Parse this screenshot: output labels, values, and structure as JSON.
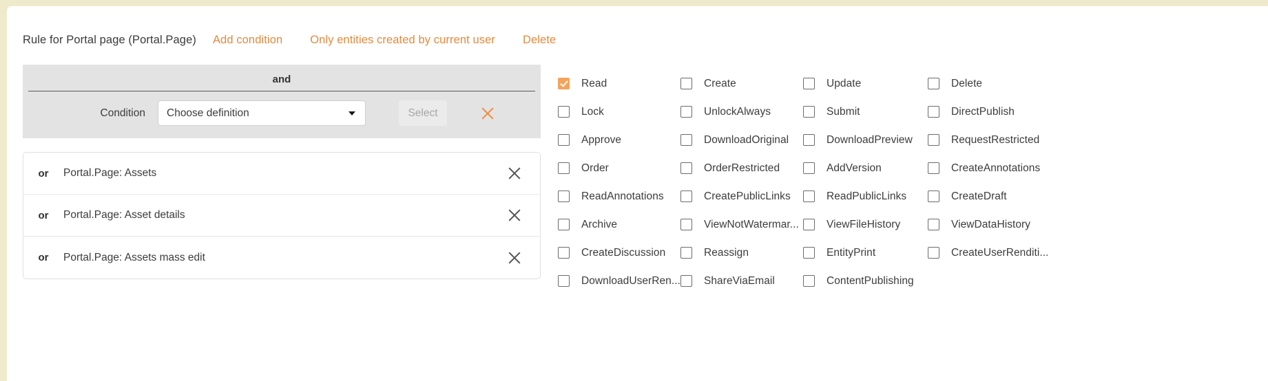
{
  "rule": {
    "title": "Rule for Portal page (Portal.Page)",
    "actions": [
      {
        "label": "Add condition",
        "name": "add-condition-link"
      },
      {
        "label": "Only entities created by current user",
        "name": "only-entities-link"
      },
      {
        "label": "Delete",
        "name": "delete-rule-link"
      }
    ]
  },
  "conditions": {
    "group_operator": "and",
    "condition_label": "Condition",
    "definition_value": "Choose definition",
    "definition_placeholder": "Choose definition",
    "select_button": "Select",
    "or_operator": "or",
    "or_rows": [
      {
        "operator": "or",
        "text": "Portal.Page: Assets"
      },
      {
        "operator": "or",
        "text": "Portal.Page: Asset details"
      },
      {
        "operator": "or",
        "text": "Portal.Page: Assets mass edit"
      }
    ]
  },
  "colors": {
    "accent": "#e8883a",
    "checkbox_checked": "#f5a35b",
    "panel_gray": "#e3e3e3",
    "page_background": "#efeacb"
  },
  "permissions": [
    {
      "label": "Read",
      "checked": true
    },
    {
      "label": "Create",
      "checked": false
    },
    {
      "label": "Update",
      "checked": false
    },
    {
      "label": "Delete",
      "checked": false
    },
    {
      "label": "Lock",
      "checked": false
    },
    {
      "label": "UnlockAlways",
      "checked": false
    },
    {
      "label": "Submit",
      "checked": false
    },
    {
      "label": "DirectPublish",
      "checked": false
    },
    {
      "label": "Approve",
      "checked": false
    },
    {
      "label": "DownloadOriginal",
      "checked": false
    },
    {
      "label": "DownloadPreview",
      "checked": false
    },
    {
      "label": "RequestRestricted",
      "checked": false
    },
    {
      "label": "Order",
      "checked": false
    },
    {
      "label": "OrderRestricted",
      "checked": false
    },
    {
      "label": "AddVersion",
      "checked": false
    },
    {
      "label": "CreateAnnotations",
      "checked": false
    },
    {
      "label": "ReadAnnotations",
      "checked": false
    },
    {
      "label": "CreatePublicLinks",
      "checked": false
    },
    {
      "label": "ReadPublicLinks",
      "checked": false
    },
    {
      "label": "CreateDraft",
      "checked": false
    },
    {
      "label": "Archive",
      "checked": false
    },
    {
      "label": "ViewNotWatermar...",
      "checked": false
    },
    {
      "label": "ViewFileHistory",
      "checked": false
    },
    {
      "label": "ViewDataHistory",
      "checked": false
    },
    {
      "label": "CreateDiscussion",
      "checked": false
    },
    {
      "label": "Reassign",
      "checked": false
    },
    {
      "label": "EntityPrint",
      "checked": false
    },
    {
      "label": "CreateUserRenditi...",
      "checked": false
    },
    {
      "label": "DownloadUserRen...",
      "checked": false
    },
    {
      "label": "ShareViaEmail",
      "checked": false
    },
    {
      "label": "ContentPublishing",
      "checked": false
    },
    {
      "label": "",
      "checked": false,
      "empty": true
    }
  ]
}
